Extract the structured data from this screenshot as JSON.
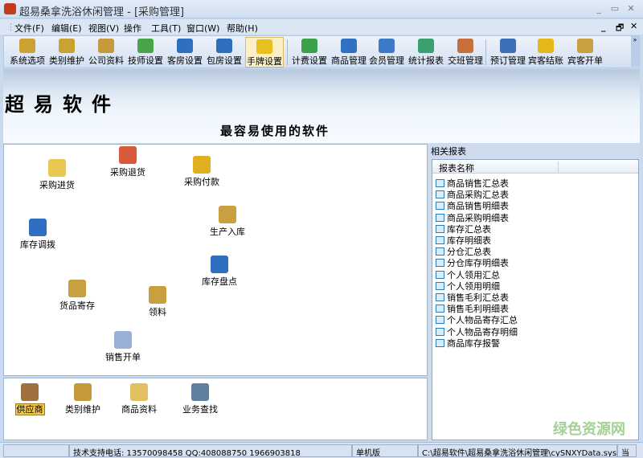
{
  "window": {
    "title": "超易桑拿洗浴休闲管理 - [采购管理]"
  },
  "menu": [
    "文件(F)",
    "编辑(E)",
    "视图(V)",
    "操作",
    "工具(T)",
    "窗口(W)",
    "帮助(H)"
  ],
  "toolbar": [
    {
      "label": "系统选项",
      "icon": "hammer-icon",
      "color": "#c9a232"
    },
    {
      "label": "类别维护",
      "icon": "hammer-icon",
      "color": "#c9a232"
    },
    {
      "label": "公司资料",
      "icon": "book-icon",
      "color": "#c49a3a"
    },
    {
      "label": "技师设置",
      "icon": "person-icon",
      "color": "#4aa54a"
    },
    {
      "label": "客房设置",
      "icon": "room-icon",
      "color": "#2e6fc0"
    },
    {
      "label": "包房设置",
      "icon": "room-icon",
      "color": "#2e6fc0"
    },
    {
      "label": "手牌设置",
      "icon": "hand-card-icon",
      "color": "#e8c020",
      "active": true
    },
    {
      "label": "计费设置",
      "icon": "money-icon",
      "color": "#3ca24a"
    },
    {
      "label": "商品管理",
      "icon": "box-icon",
      "color": "#2f72c4"
    },
    {
      "label": "会员管理",
      "icon": "member-icon",
      "color": "#3d7ac9"
    },
    {
      "label": "统计报表",
      "icon": "chart-icon",
      "color": "#3aa070"
    },
    {
      "label": "交班管理",
      "icon": "people-icon",
      "color": "#c8703a"
    },
    {
      "label": "预订管理",
      "icon": "stapler-icon",
      "color": "#3d6fb8"
    },
    {
      "label": "宾客结账",
      "icon": "yen-icon",
      "color": "#e8b818"
    },
    {
      "label": "宾客开单",
      "icon": "package-icon",
      "color": "#c9a040"
    }
  ],
  "banner": {
    "brand": "超易软件",
    "slogan": "最容易使用的软件"
  },
  "main_items": [
    {
      "label": "采购进货",
      "icon": "purchase-add-icon",
      "color": "#e8c850"
    },
    {
      "label": "采购退货",
      "icon": "purchase-return-icon",
      "color": "#d95a3a"
    },
    {
      "label": "采购付款",
      "icon": "payment-icon",
      "color": "#e0b020"
    },
    {
      "label": "库存调拨",
      "icon": "transfer-icon",
      "color": "#2e6fc0"
    },
    {
      "label": "生产入库",
      "icon": "package-icon",
      "color": "#c9a040"
    },
    {
      "label": "库存盘点",
      "icon": "inventory-icon",
      "color": "#2e6fc0"
    },
    {
      "label": "货品寄存",
      "icon": "package-icon",
      "color": "#c9a040"
    },
    {
      "label": "领料",
      "icon": "package-icon",
      "color": "#c9a040"
    },
    {
      "label": "销售开单",
      "icon": "sales-add-icon",
      "color": "#9ab0d8"
    }
  ],
  "bottom_items": [
    {
      "label": "供应商",
      "icon": "supplier-icon",
      "color": "#a07040"
    },
    {
      "label": "类别维护",
      "icon": "category-icon",
      "color": "#c49a3a"
    },
    {
      "label": "商品资料",
      "icon": "goods-icon",
      "color": "#e0c060"
    },
    {
      "label": "业务查找",
      "icon": "binoculars-icon",
      "color": "#6080a0"
    }
  ],
  "reports": {
    "title": "相关报表",
    "column": "报表名称",
    "items": [
      "商品销售汇总表",
      "商品采购汇总表",
      "商品销售明细表",
      "商品采购明细表",
      "库存汇总表",
      "库存明细表",
      "分仓汇总表",
      "分仓库存明细表",
      "个人领用汇总",
      "个人领用明细",
      "销售毛利汇总表",
      "销售毛利明细表",
      "个人物品寄存汇总",
      "个人物品寄存明细",
      "商品库存报警"
    ]
  },
  "status": {
    "support": "技术支持电话: 13570098458 QQ:408088750 1966903818",
    "mode": "单机版",
    "path": "C:\\超易软件\\超易桑拿洗浴休闲管理\\cySNXYData.sys",
    "extra": "当"
  },
  "watermark": "绿色资源网"
}
